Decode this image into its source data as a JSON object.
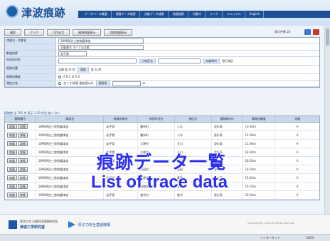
{
  "header": {
    "logo_text": "津波痕跡",
    "nav": [
      "データベース概要",
      "痕跡データ検索",
      "文献データ検索",
      "地図検索",
      "対象外",
      "リンク",
      "マニュアル",
      "English"
    ]
  },
  "toolbar": {
    "buttons": [
      "検索",
      "クリア",
      "CSV出力",
      "痕跡地図表示",
      "文献地図表示"
    ],
    "count_label": "表示件数 20"
  },
  "form": {
    "rows": [
      {
        "label": "津波名・文献名",
        "value": "1896明治三陸地震津波",
        "sub_label": "出典名",
        "sub_value": ""
      },
      {
        "label": "",
        "value": "文献番号 すべての文献"
      },
      {
        "label": "都道府県",
        "value": "岩手県",
        "sub_label": "",
        "sub_value": ""
      },
      {
        "label": "市区町村名",
        "value": "",
        "sub_label": "小地区名",
        "sub_value": "",
        "extra_label": "文献時代",
        "extra_value": "現行政区"
      },
      {
        "label": "痕跡位置",
        "value": "北緯 度 分 秒",
        "sub_label": "東経",
        "sub_value": "度 分 秒"
      },
      {
        "label": "痕跡信頼度",
        "value": "A B C D X Z"
      },
      {
        "label": "測定方法",
        "value": "全て 計測値 推定値以外",
        "sub_label": "痕跡高",
        "sub_value": "m"
      }
    ]
  },
  "pager": "痕跡数 全 765 件 表示 1 20 件目  前へ 次へ",
  "table": {
    "headers": [
      "痕跡番号",
      "津波名",
      "都道府県名",
      "市区町村名",
      "地区名",
      "痕跡高(m)",
      "痕跡信頼度",
      "文献"
    ],
    "row_buttons": [
      "地図",
      "詳細"
    ],
    "rows": [
      {
        "quake": "1896明治三陸地震津波",
        "pref": "岩手県",
        "city": "種市町",
        "place": "八木",
        "kind": "浸水高",
        "height": "10.30m",
        "rel": "A"
      },
      {
        "quake": "1896明治三陸地震津波",
        "pref": "岩手県",
        "city": "種市町",
        "place": "八木",
        "kind": "浸水高",
        "height": "15.30m",
        "rel": "A"
      },
      {
        "quake": "1896明治三陸地震津波",
        "pref": "岩手県",
        "city": "大野村",
        "place": "玉川",
        "kind": "浸水高",
        "height": "11.00m",
        "rel": "A"
      },
      {
        "quake": "1896明治三陸地震津波",
        "pref": "岩手県",
        "city": "久慈市",
        "place": "玉川",
        "kind": "浸水高",
        "height": "18.30m",
        "rel": "A"
      },
      {
        "quake": "1896明治三陸地震津波",
        "pref": "岩手県",
        "city": "野田村",
        "place": "野田",
        "kind": "遡上高",
        "height": "20.30m",
        "rel": "A"
      },
      {
        "quake": "1896明治三陸地震津波",
        "pref": "岩手県",
        "city": "野田村",
        "place": "野田",
        "kind": "浸水高",
        "height": "18.20m",
        "rel": "A"
      },
      {
        "quake": "1896明治三陸地震津波",
        "pref": "岩手県",
        "city": "田野畑村",
        "place": "羅賀",
        "kind": "浸水高",
        "height": "15.60m",
        "rel": "A"
      },
      {
        "quake": "1896明治三陸地震津波",
        "pref": "岩手県",
        "city": "田野畑村",
        "place": "島越",
        "kind": "浸水高",
        "height": "19.70m",
        "rel": "A"
      },
      {
        "quake": "1896明治三陸地震津波",
        "pref": "岩手県",
        "city": "普代村",
        "place": "普代",
        "kind": "浸水高",
        "height": "20.30m",
        "rel": "A"
      }
    ]
  },
  "overlay": {
    "title_jp": "痕跡データ一覧",
    "title_en": "List of trace data"
  },
  "footer": {
    "org_small": "東北大学 災害科学国際研究所",
    "org_name": "津波工学研究室",
    "partner": "原子力安全基盤機構",
    "copyright": "Copyright(C) 2014 All rights reserved."
  },
  "status": {
    "zone": "インターネット",
    "zoom": "100%"
  },
  "colors": {
    "nav_bg": "#1e4f95",
    "overlay_text": "#2a2ff0",
    "label_bg": "#d7e4f3"
  }
}
